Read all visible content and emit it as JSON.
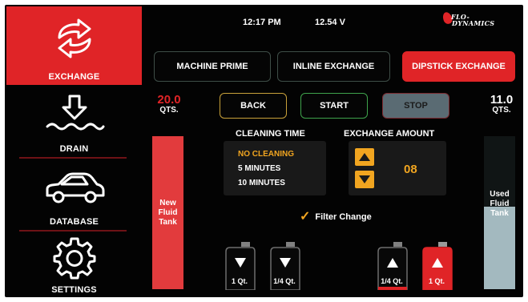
{
  "sidebar": {
    "items": [
      {
        "label": "EXCHANGE",
        "icon": "exchange-arrows-icon",
        "active": true
      },
      {
        "label": "DRAIN",
        "icon": "drain-arrow-icon",
        "active": false
      },
      {
        "label": "DATABASE",
        "icon": "car-icon",
        "active": false
      },
      {
        "label": "SETTINGS",
        "icon": "gear-icon",
        "active": false
      }
    ]
  },
  "status": {
    "time": "12:17 PM",
    "voltage": "12.54 V"
  },
  "logo": {
    "line1": "FLO-",
    "line2": "DYNAMICS"
  },
  "modes": [
    {
      "label": "MACHINE PRIME",
      "active": false
    },
    {
      "label": "INLINE EXCHANGE",
      "active": false
    },
    {
      "label": "DIPSTICK EXCHANGE",
      "active": true
    }
  ],
  "actions": {
    "back": "BACK",
    "start": "START",
    "stop": "STOP"
  },
  "new_tank": {
    "qty": "20.0",
    "unit": "QTS.",
    "line1": "New",
    "line2": "Fluid",
    "line3": "Tank",
    "fill_fraction": 1.0
  },
  "used_tank": {
    "qty": "11.0",
    "unit": "QTS.",
    "line1": "Used",
    "line2": "Fluid",
    "line3": "Tank",
    "fill_fraction": 0.54
  },
  "cleaning": {
    "title": "CLEANING TIME",
    "options": [
      "NO CLEANING",
      "5 MINUTES",
      "10 MINUTES"
    ],
    "selected": "NO CLEANING"
  },
  "exchange": {
    "title": "EXCHANGE AMOUNT",
    "value": "08"
  },
  "filter": {
    "label": "Filter Change",
    "checked": true
  },
  "jugs": [
    {
      "label": "1 Qt.",
      "direction": "down",
      "active": false
    },
    {
      "label": "1/4 Qt.",
      "direction": "down",
      "active": false
    },
    {
      "label": "1/4 Qt.",
      "direction": "up",
      "active": false
    },
    {
      "label": "1 Qt.",
      "direction": "up",
      "active": true
    }
  ],
  "colors": {
    "accent_red": "#e02427",
    "accent_amber": "#f1a520",
    "used_fluid": "#a3b9bf",
    "start_green": "#3fa34c",
    "stop_gray": "#5a6b73"
  }
}
